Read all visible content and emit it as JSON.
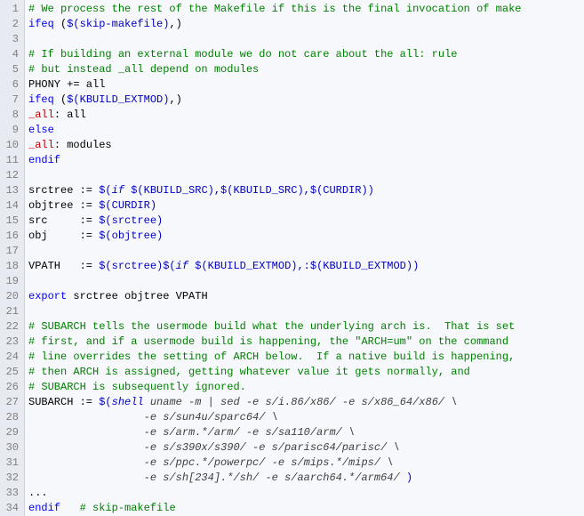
{
  "lines": [
    {
      "num": 1,
      "segments": [
        {
          "cls": "comment",
          "text": "# We process the rest of the Makefile if this is the final invocation of make"
        }
      ]
    },
    {
      "num": 2,
      "segments": [
        {
          "cls": "keyword",
          "text": "ifeq"
        },
        {
          "cls": "",
          "text": " ("
        },
        {
          "cls": "variable",
          "text": "$(skip-makefile)"
        },
        {
          "cls": "",
          "text": ",)"
        }
      ]
    },
    {
      "num": 3,
      "segments": []
    },
    {
      "num": 4,
      "segments": [
        {
          "cls": "comment",
          "text": "# If building an external module we do not care about the all: rule"
        }
      ]
    },
    {
      "num": 5,
      "segments": [
        {
          "cls": "comment",
          "text": "# but instead _all depend on modules"
        }
      ]
    },
    {
      "num": 6,
      "segments": [
        {
          "cls": "",
          "text": "PHONY += all"
        }
      ]
    },
    {
      "num": 7,
      "segments": [
        {
          "cls": "keyword",
          "text": "ifeq"
        },
        {
          "cls": "",
          "text": " ("
        },
        {
          "cls": "variable",
          "text": "$(KBUILD_EXTMOD)"
        },
        {
          "cls": "",
          "text": ",)"
        }
      ]
    },
    {
      "num": 8,
      "segments": [
        {
          "cls": "target",
          "text": "_all"
        },
        {
          "cls": "",
          "text": ": all"
        }
      ]
    },
    {
      "num": 9,
      "segments": [
        {
          "cls": "keyword",
          "text": "else"
        }
      ]
    },
    {
      "num": 10,
      "segments": [
        {
          "cls": "target",
          "text": "_all"
        },
        {
          "cls": "",
          "text": ": modules"
        }
      ]
    },
    {
      "num": 11,
      "segments": [
        {
          "cls": "keyword",
          "text": "endif"
        }
      ]
    },
    {
      "num": 12,
      "segments": []
    },
    {
      "num": 13,
      "segments": [
        {
          "cls": "",
          "text": "srctree := "
        },
        {
          "cls": "variable",
          "text": "$("
        },
        {
          "cls": "func",
          "text": "if"
        },
        {
          "cls": "variable",
          "text": " $(KBUILD_SRC),$(KBUILD_SRC),$(CURDIR))"
        }
      ]
    },
    {
      "num": 14,
      "segments": [
        {
          "cls": "",
          "text": "objtree := "
        },
        {
          "cls": "variable",
          "text": "$(CURDIR)"
        }
      ]
    },
    {
      "num": 15,
      "segments": [
        {
          "cls": "",
          "text": "src     := "
        },
        {
          "cls": "variable",
          "text": "$(srctree)"
        }
      ]
    },
    {
      "num": 16,
      "segments": [
        {
          "cls": "",
          "text": "obj     := "
        },
        {
          "cls": "variable",
          "text": "$(objtree)"
        }
      ]
    },
    {
      "num": 17,
      "segments": []
    },
    {
      "num": 18,
      "segments": [
        {
          "cls": "",
          "text": "VPATH   := "
        },
        {
          "cls": "variable",
          "text": "$(srctree)$("
        },
        {
          "cls": "func",
          "text": "if"
        },
        {
          "cls": "variable",
          "text": " $(KBUILD_EXTMOD),:$(KBUILD_EXTMOD))"
        }
      ]
    },
    {
      "num": 19,
      "segments": []
    },
    {
      "num": 20,
      "segments": [
        {
          "cls": "keyword",
          "text": "export"
        },
        {
          "cls": "",
          "text": " srctree objtree VPATH"
        }
      ]
    },
    {
      "num": 21,
      "segments": []
    },
    {
      "num": 22,
      "segments": [
        {
          "cls": "comment",
          "text": "# SUBARCH tells the usermode build what the underlying arch is.  That is set"
        }
      ]
    },
    {
      "num": 23,
      "segments": [
        {
          "cls": "comment",
          "text": "# first, and if a usermode build is happening, the \"ARCH=um\" on the command"
        }
      ]
    },
    {
      "num": 24,
      "segments": [
        {
          "cls": "comment",
          "text": "# line overrides the setting of ARCH below.  If a native build is happening,"
        }
      ]
    },
    {
      "num": 25,
      "segments": [
        {
          "cls": "comment",
          "text": "# then ARCH is assigned, getting whatever value it gets normally, and"
        }
      ]
    },
    {
      "num": 26,
      "segments": [
        {
          "cls": "comment",
          "text": "# SUBARCH is subsequently ignored."
        }
      ]
    },
    {
      "num": 27,
      "segments": [
        {
          "cls": "",
          "text": "SUBARCH := "
        },
        {
          "cls": "variable",
          "text": "$("
        },
        {
          "cls": "func",
          "text": "shell"
        },
        {
          "cls": "string",
          "text": " uname -m | sed -e s/i.86/x86/ -e s/x86_64/x86/ \\"
        }
      ]
    },
    {
      "num": 28,
      "segments": [
        {
          "cls": "string",
          "text": "                  -e s/sun4u/sparc64/ \\"
        }
      ]
    },
    {
      "num": 29,
      "segments": [
        {
          "cls": "string",
          "text": "                  -e s/arm.*/arm/ -e s/sa110/arm/ \\"
        }
      ]
    },
    {
      "num": 30,
      "segments": [
        {
          "cls": "string",
          "text": "                  -e s/s390x/s390/ -e s/parisc64/parisc/ \\"
        }
      ]
    },
    {
      "num": 31,
      "segments": [
        {
          "cls": "string",
          "text": "                  -e s/ppc.*/powerpc/ -e s/mips.*/mips/ \\"
        }
      ]
    },
    {
      "num": 32,
      "segments": [
        {
          "cls": "string",
          "text": "                  -e s/sh[234].*/sh/ -e s/aarch64.*/arm64/ "
        },
        {
          "cls": "variable",
          "text": ")"
        }
      ]
    },
    {
      "num": 33,
      "segments": [
        {
          "cls": "",
          "text": "..."
        }
      ]
    },
    {
      "num": 34,
      "segments": [
        {
          "cls": "keyword",
          "text": "endif"
        },
        {
          "cls": "",
          "text": "   "
        },
        {
          "cls": "comment",
          "text": "# skip-makefile"
        }
      ]
    }
  ]
}
